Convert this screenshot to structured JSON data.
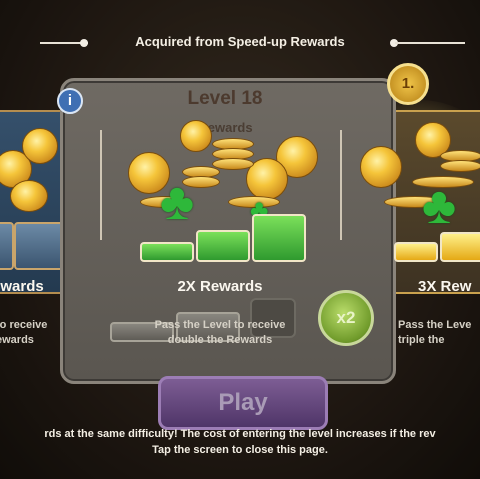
{
  "header": {
    "title": "Acquired from Speed-up Rewards"
  },
  "dialog": {
    "level_title": "Level 18",
    "subheader": "Rewards",
    "info_icon_label": "i",
    "badge_text": "1."
  },
  "cards": [
    {
      "title": "ewards",
      "desc_line1": "to receive",
      "desc_line2": "ewards"
    },
    {
      "title": "2X Rewards",
      "desc_line1": "Pass the Level to receive",
      "desc_line2": "double the Rewards"
    },
    {
      "title": "3X Rew",
      "desc_line1": "Pass the Leve",
      "desc_line2": "triple the"
    }
  ],
  "multiplier_badge": "x2",
  "play_button": "Play",
  "footer": {
    "line1": "rds at the same difficulty! The cost of entering the level increases if the rev",
    "line2": "Tap the screen to close this page."
  },
  "colors": {
    "accent_green": "#2eb83a",
    "gold": "#f5c53a",
    "play_purple": "#5d4178"
  }
}
